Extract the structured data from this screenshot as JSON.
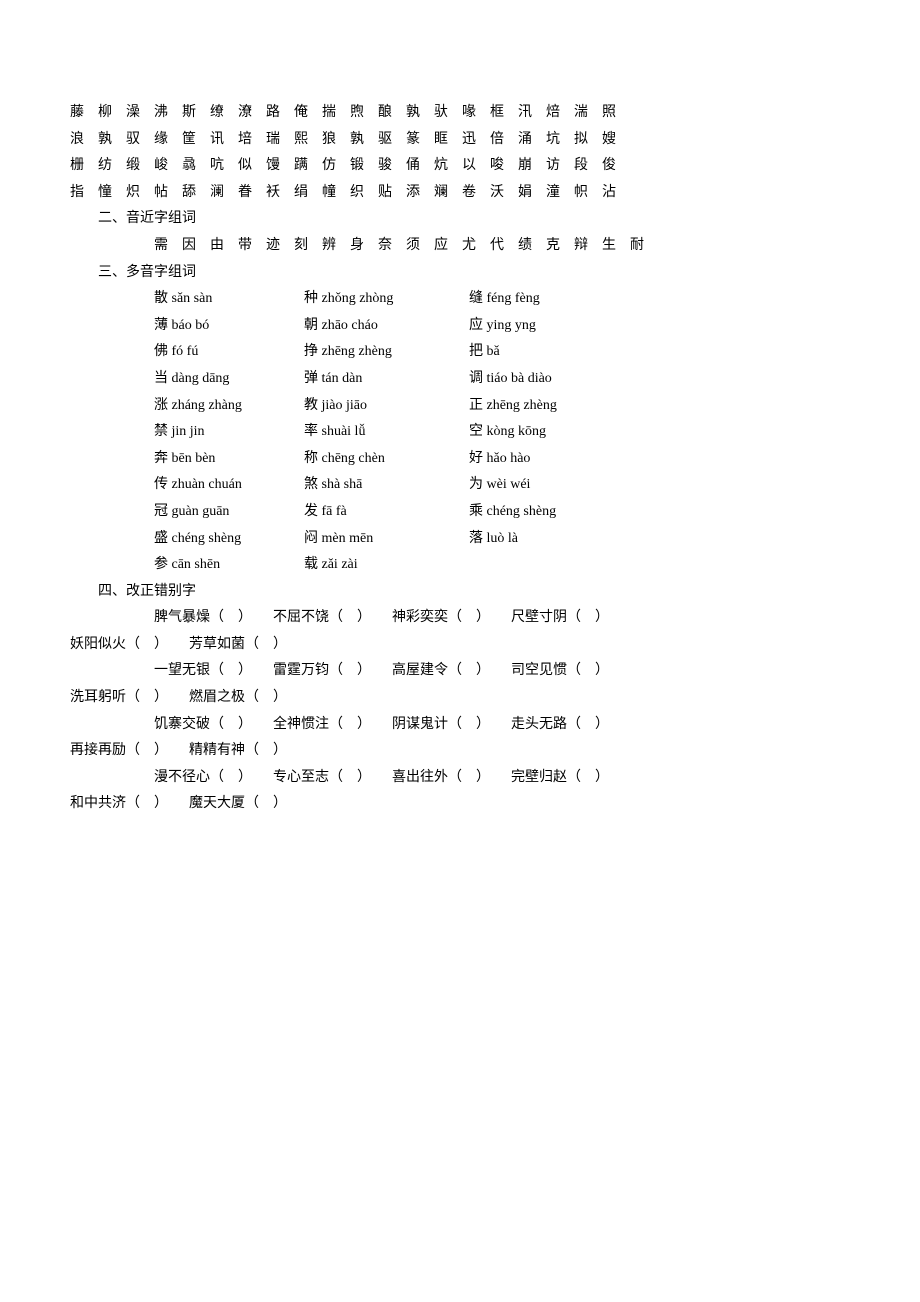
{
  "charRows": [
    "藤　柳　澡　沸　斯　缭　潦　路　俺　揣　煦　酿　孰　驮　喙　框　汛　焙　湍　照",
    "浪　孰　驭　缘　筐　讯　培　瑞　熙　狼　孰　驱　篆　眶　迅　倍　涌　坑　拟　嫂",
    "栅　纺　缎　峻　骉　吭　似　馒　蹒　仿　锻　骏　俑　炕　以　唆　崩　访　段　俊",
    "指　憧　炽　帖　舔　澜　眷　袄　绢　幢　织　贴　添　斓　卷　沃　娟　潼　帜　沾"
  ],
  "sections": {
    "s2": "二、音近字组词",
    "s3": "三、多音字组词",
    "s4": "四、改正错别字"
  },
  "nearRow": "需　因　由　带　迹　刻　辨　身　奈　须　应　尤　代　绩　克　辩　生　耐",
  "polyRows": [
    [
      "散 sǎn sàn",
      "种 zhǒng zhòng",
      "缝 féng fèng"
    ],
    [
      "薄 báo bó",
      "朝 zhāo cháo",
      "应 ying yng"
    ],
    [
      "佛 fó fú",
      "挣 zhēng zhèng",
      "把 bǎ"
    ],
    [
      "当 dàng dāng",
      "弹 tán dàn",
      "调 tiáo bà diào"
    ],
    [
      "涨 zháng zhàng",
      "教 jiào jiāo",
      "正 zhēng zhèng"
    ],
    [
      "禁 jin jin",
      "率 shuài lǚ",
      "空 kòng kōng"
    ],
    [
      "奔 bēn bèn",
      "称 chēng chèn",
      "好 hǎo hào"
    ],
    [
      "传 zhuàn chuán",
      "煞 shà shā",
      "为 wèi wéi"
    ],
    [
      "冠 guàn guān",
      "发 fā fà",
      "乘 chéng shèng"
    ],
    [
      "盛 chéng shèng",
      "闷 mèn mēn",
      "落 luò là"
    ],
    [
      "参 cān shēn",
      "载 zǎi zài",
      ""
    ]
  ],
  "errLines": [
    {
      "indent": true,
      "text": "脾气暴燥（　）　　不屈不饶（　）　　神彩奕奕（　）　　尺壁寸阴（　）"
    },
    {
      "indent": false,
      "text": "妖阳似火（　）　　芳草如菌（　）"
    },
    {
      "indent": true,
      "text": "一望无银（　）　　雷霆万钧（　）　　高屋建令（　）　　司空见惯（　）"
    },
    {
      "indent": false,
      "text": "洗耳躬听（　）　　燃眉之极（　）"
    },
    {
      "indent": true,
      "text": "饥寨交破（　）　　全神惯注（　）　　阴谋鬼计（　）　　走头无路（　）"
    },
    {
      "indent": false,
      "text": "再接再励（　）　　精精有神（　）"
    },
    {
      "indent": true,
      "text": "漫不径心（　）　　专心至志（　）　　喜出往外（　）　　完壁归赵（　）"
    },
    {
      "indent": false,
      "text": "和中共济（　）　　魔天大厦（　）"
    }
  ]
}
